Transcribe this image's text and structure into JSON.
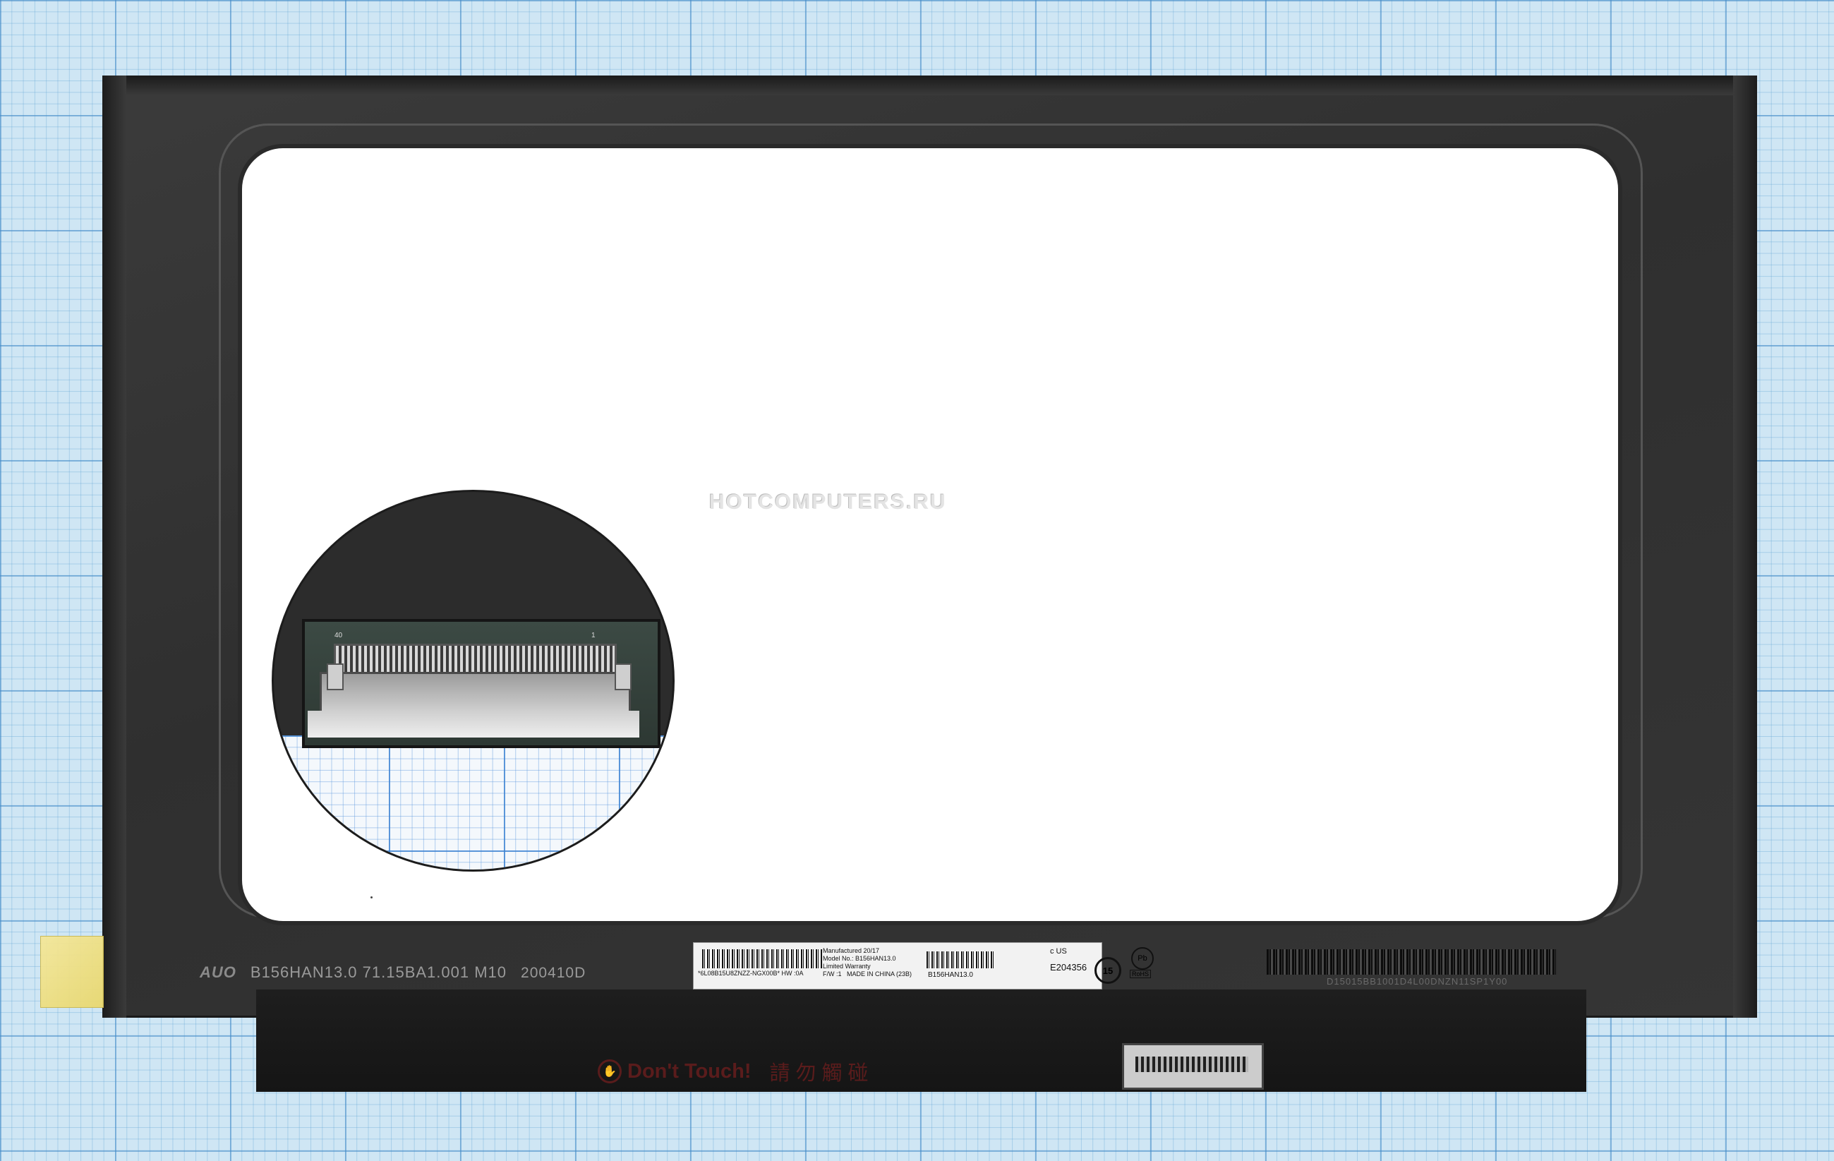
{
  "image": {
    "subject": "laptop-lcd-panel",
    "watermark": "HOTCOMPUTERS.RU"
  },
  "bezel": {
    "brand_logo": "AUO",
    "model_text": "B156HAN13.0 71.15BA1.001 M10",
    "code_text": "200410D"
  },
  "sticker": {
    "barcode1_text": "*6L08B15U8ZNZZ-NGX00B* HW :0A",
    "manufactured": "Manufactured 20/17",
    "model_no": "Model No.: B156HAN13.0",
    "warranty": "Limited Warranty",
    "fw": "F/W :1",
    "made_in": "MADE IN CHINA (23B)",
    "barcode2_text": "B156HAN13.0",
    "ul_mark": "c US",
    "cert_number": "E204356",
    "rohs": "RoHS",
    "pb": "Pb",
    "fifteen": "15"
  },
  "right_barcode_text": "D15015BB1001D4L00DNZN11SP1Y00",
  "strip": {
    "warning_text": "Don't Touch!",
    "warning_cjk": "請勿觸碰",
    "warning_symbol": "✋"
  },
  "zoom": {
    "left_mark": "40",
    "right_mark": "1"
  },
  "colors": {
    "panel": "#333333",
    "screen": "#ffffff",
    "grid_paper": "#cfe6f4",
    "warning_text": "#5a1c1c"
  }
}
